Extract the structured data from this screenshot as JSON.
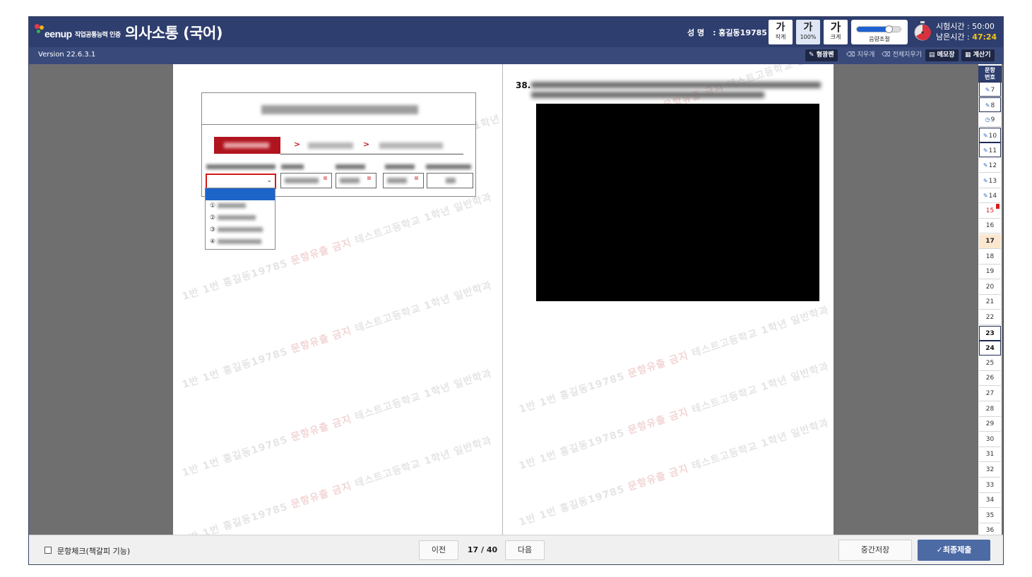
{
  "header": {
    "logo_text": "eenup",
    "logo_sub": "직업공통능력 인증",
    "title": "의사소통 (국어)",
    "name_label": "성 명",
    "name_value": ": 홍길동19785",
    "font_buttons": [
      {
        "glyph": "가",
        "label": "작게"
      },
      {
        "glyph": "가",
        "label": "100%"
      },
      {
        "glyph": "가",
        "label": "크게"
      }
    ],
    "volume_label": "음량조절",
    "volume_level": 0.75,
    "exam_time_label": "시험시간 : 50:00",
    "remaining_label": "남은시간 : ",
    "remaining_value": "47:24"
  },
  "toolbar": {
    "version": "Version 22.6.3.1",
    "tools": [
      "형광펜",
      "지우개",
      "전체지우기",
      "메모장",
      "계산기"
    ]
  },
  "watermark": {
    "text_a": "1반 1번 홍길동19785 ",
    "text_red": "문항유출 금지",
    "text_b": " 테스트고등학교 1학년 일반학과"
  },
  "question": {
    "number": "38."
  },
  "dropdown_options": [
    "①",
    "②",
    "③",
    "④"
  ],
  "question_nav": {
    "title_line1": "문항",
    "title_line2": "번호",
    "items": [
      {
        "num": "7",
        "state": "boxed-answered"
      },
      {
        "num": "8",
        "state": "boxed-answered"
      },
      {
        "num": "9",
        "state": "clock"
      },
      {
        "num": "10",
        "state": "boxed-answered"
      },
      {
        "num": "11",
        "state": "boxed-answered"
      },
      {
        "num": "12",
        "state": "answered"
      },
      {
        "num": "13",
        "state": "answered"
      },
      {
        "num": "14",
        "state": "answered"
      },
      {
        "num": "15",
        "state": "marked"
      },
      {
        "num": "16",
        "state": "plain"
      },
      {
        "num": "17",
        "state": "current"
      },
      {
        "num": "18",
        "state": "plain"
      },
      {
        "num": "19",
        "state": "plain"
      },
      {
        "num": "20",
        "state": "plain"
      },
      {
        "num": "21",
        "state": "plain"
      },
      {
        "num": "22",
        "state": "plain"
      },
      {
        "num": "23",
        "state": "boxed-bold"
      },
      {
        "num": "24",
        "state": "boxed-bold"
      },
      {
        "num": "25",
        "state": "plain"
      },
      {
        "num": "26",
        "state": "plain"
      },
      {
        "num": "27",
        "state": "plain"
      },
      {
        "num": "28",
        "state": "plain"
      },
      {
        "num": "29",
        "state": "plain"
      },
      {
        "num": "30",
        "state": "plain"
      },
      {
        "num": "31",
        "state": "plain"
      },
      {
        "num": "32",
        "state": "plain"
      },
      {
        "num": "33",
        "state": "plain"
      },
      {
        "num": "34",
        "state": "plain"
      },
      {
        "num": "35",
        "state": "plain"
      },
      {
        "num": "36",
        "state": "plain"
      }
    ]
  },
  "bottom": {
    "bookmark_label": "문항체크(책갈피 기능)",
    "prev_label": "이전",
    "page_indicator": "17 / 40",
    "next_label": "다음",
    "save_label": "중간저장",
    "submit_label": "✓최종제출"
  },
  "colors": {
    "header_bg": "#2e3e6e",
    "toolbar_bg": "#394a7a",
    "accent_red": "#b0141e",
    "remaining_time": "#f5c518",
    "submit_bg": "#4c6aa3"
  }
}
